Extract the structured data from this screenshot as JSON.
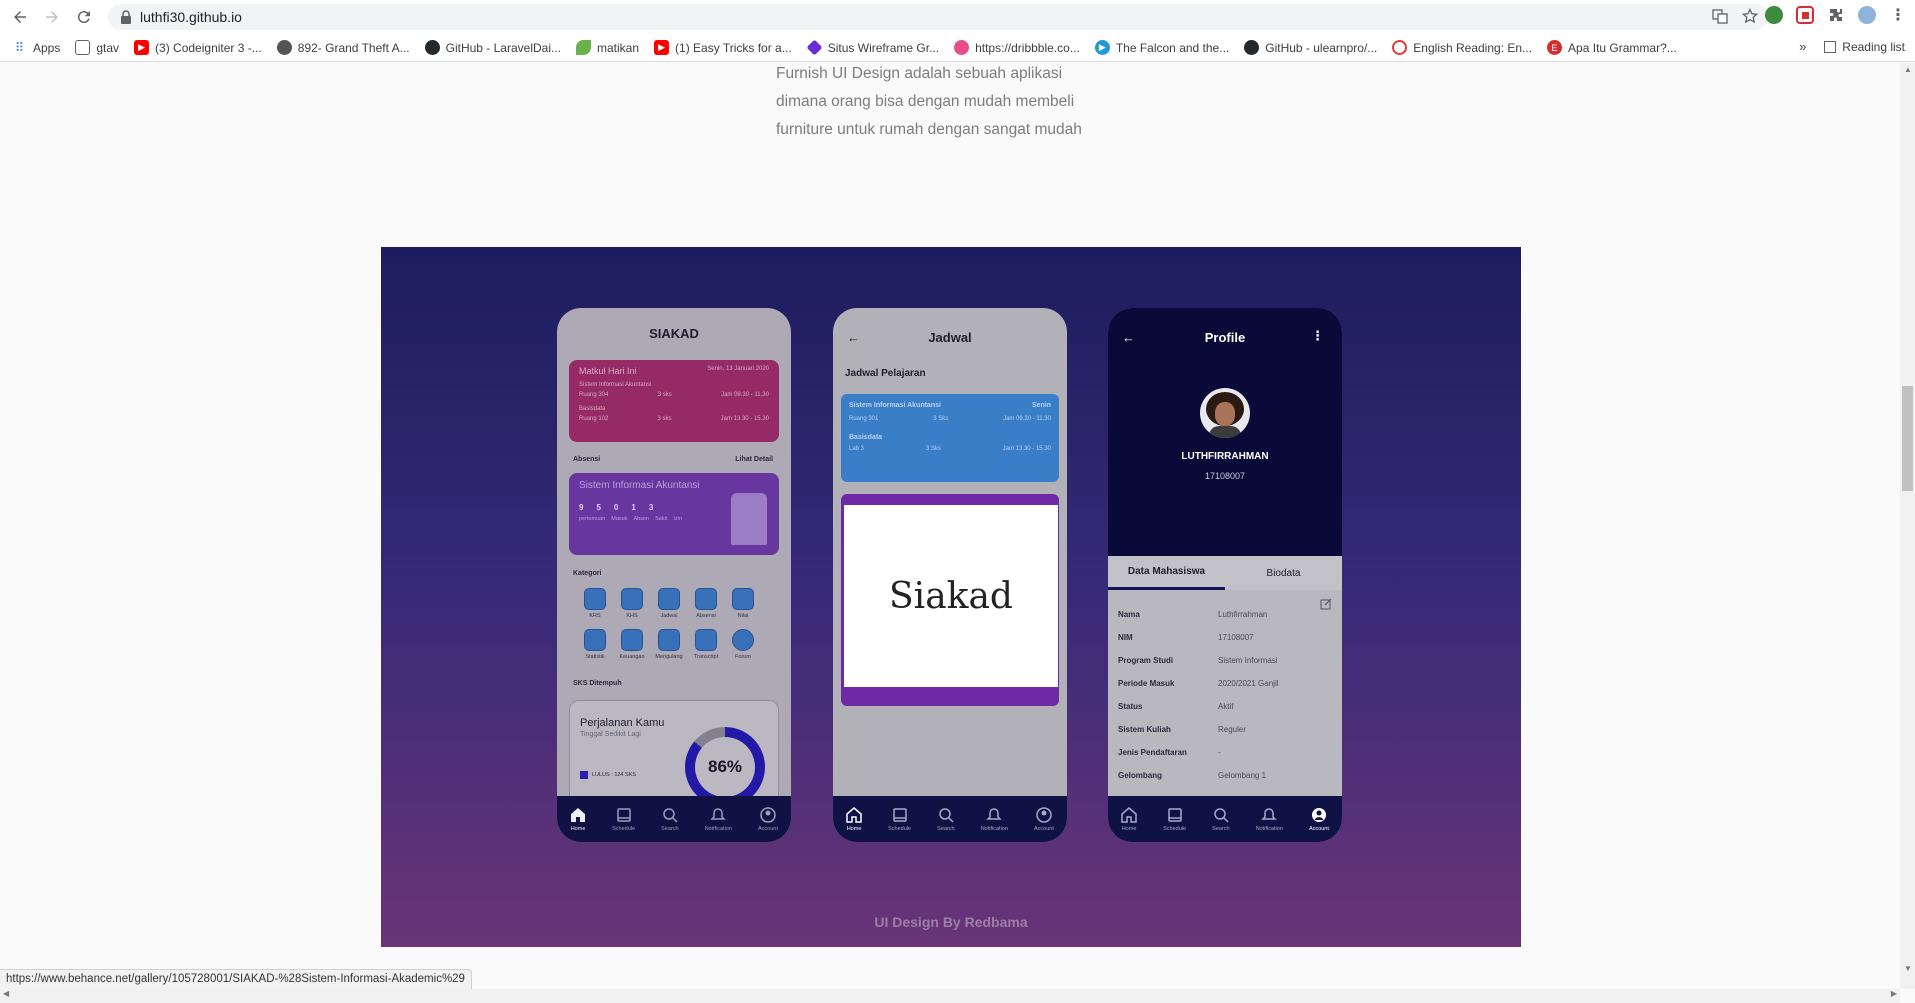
{
  "browser": {
    "url": "luthfi30.github.io",
    "bookmarks": [
      {
        "label": "Apps",
        "icon": "apps-grid-icon",
        "color": "#4285f4"
      },
      {
        "label": "gtav",
        "icon": "page-icon",
        "color": "#5f6368"
      },
      {
        "label": "(3) Codeigniter 3 -...",
        "icon": "youtube-icon",
        "color": "#ff0000"
      },
      {
        "label": "892- Grand Theft A...",
        "icon": "globe-icon",
        "color": "#555555"
      },
      {
        "label": "GitHub - LaravelDai...",
        "icon": "github-icon",
        "color": "#24292e"
      },
      {
        "label": "matikan",
        "icon": "leaf-icon",
        "color": "#6ab04c"
      },
      {
        "label": "(1) Easy Tricks for a...",
        "icon": "youtube-icon",
        "color": "#ff0000"
      },
      {
        "label": "Situs Wireframe Gr...",
        "icon": "diamond-icon",
        "color": "#6c2bd9"
      },
      {
        "label": "https://dribbble.co...",
        "icon": "dribbble-icon",
        "color": "#ea4c89"
      },
      {
        "label": "The Falcon and the...",
        "icon": "play-icon",
        "color": "#1e9bd7"
      },
      {
        "label": "GitHub - ulearnpro/...",
        "icon": "github-icon",
        "color": "#24292e"
      },
      {
        "label": "English Reading: En...",
        "icon": "circle-icon",
        "color": "#e53935"
      },
      {
        "label": "Apa Itu Grammar?...",
        "icon": "e-icon",
        "color": "#d32f2f"
      }
    ],
    "reading_list": "Reading list",
    "status_url": "https://www.behance.net/gallery/105728001/SIAKAD-%28Sistem-Informasi-Akademic%29"
  },
  "page": {
    "intro_lines": [
      "Furnish UI Design adalah sebuah aplikasi",
      "dimana orang bisa dengan mudah membeli",
      "furniture untuk rumah dengan sangat mudah"
    ],
    "credit": "UI Design By Redbama",
    "overlay_title": "Siakad"
  },
  "phone1": {
    "title": "SIAKAD",
    "today_card": {
      "title": "Matkul Hari Ini",
      "date": "Senin, 13 Januari 2020",
      "rows": [
        {
          "name": "Sistem Informasi Akuntansi",
          "room": "Ruang 304",
          "sks": "3 sks",
          "time": "Jam 09.30 - 11.30"
        },
        {
          "name": "Basisdata",
          "room": "Ruang 102",
          "sks": "3 sks",
          "time": "Jam 13.30 - 15.30"
        }
      ]
    },
    "absensi_label": "Absensi",
    "lihat_detail": "Lihat Detail",
    "absen_card": {
      "title": "Sistem Informasi Akuntansi",
      "numbers": [
        "9",
        "5",
        "0",
        "1",
        "3"
      ],
      "labels": [
        "pertemuan",
        "Masuk",
        "Absen",
        "Sakit",
        "Izin"
      ]
    },
    "kategori_label": "Kategori",
    "categories": [
      "KRS",
      "KHS",
      "Jadwal",
      "Absensi",
      "Nilai",
      "Statistik",
      "Keuangan",
      "Mengulang",
      "Transcript",
      "Forum"
    ],
    "sks_label": "SKS Ditempuh",
    "journey": {
      "title": "Perjalanan Kamu",
      "subtitle": "Tinggal Sedikit Lagi",
      "legend": "LULUS : 124 SKS",
      "percent": "86%",
      "percent_value": 0.86
    }
  },
  "phone2": {
    "title": "Jadwal",
    "subtitle": "Jadwal Pelajaran",
    "card": {
      "course1": "Sistem Informasi Akuntansi",
      "day": "Senin",
      "room1": "Ruang 301",
      "sks1": "3 Sks",
      "time1": "Jam 09.30 - 11.30",
      "course2": "Basisdata",
      "room2": "Lab 3",
      "sks2": "3 Sks",
      "time2": "Jam 13.30 - 15.30"
    }
  },
  "phone3": {
    "title": "Profile",
    "name": "LUTHFIRRAHMAN",
    "nim": "17108007",
    "tabs": [
      "Data Mahasiswa",
      "Biodata"
    ],
    "fields": [
      {
        "k": "Nama",
        "v": "Luthfirrahman"
      },
      {
        "k": "NIM",
        "v": "17108007"
      },
      {
        "k": "Program Studi",
        "v": "Sistem Informasi"
      },
      {
        "k": "Periode Masuk",
        "v": "2020/2021 Ganjil"
      },
      {
        "k": "Status",
        "v": "Aktif"
      },
      {
        "k": "Sistem Kuliah",
        "v": "Reguler"
      },
      {
        "k": "Jenis Pendaftaran",
        "v": "-"
      },
      {
        "k": "Gelombang",
        "v": "Gelombang 1"
      }
    ]
  },
  "tabbar": [
    "Home",
    "Schedule",
    "Search",
    "Notification",
    "Account"
  ]
}
